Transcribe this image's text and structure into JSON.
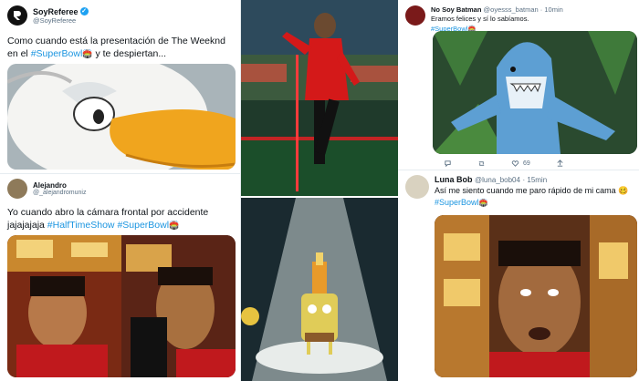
{
  "tweet1": {
    "name": "SoyReferee",
    "handle": "@SoyReferee",
    "text_pre": "Como cuando está la presentación de The Weeknd en el ",
    "hashtag": "#SuperBowl",
    "emoji": "🏟️",
    "text_post": " y te despiertan..."
  },
  "tweet2": {
    "name": "Alejandro",
    "handle": "@_alejandromuniz",
    "text_line1": "Yo cuando abro la cámara frontal por accidente",
    "text_pre": "jajajajaja ",
    "hashtag1": "#HalfTimeShow",
    "hashtag2": "#SuperBowl",
    "emoji": "🏟️"
  },
  "tweet3": {
    "name": "No Soy Batman",
    "handle": "@oyesss_batman",
    "time": "· 10min",
    "text": "Eramos felices y sí lo sabíamos.",
    "hashtag": "#SuperBowl",
    "emoji": "🏟️",
    "likes": "69"
  },
  "tweet4": {
    "name": "Luna Bob",
    "handle": "@luna_bob04",
    "time": "· 15min",
    "text": "Así me siento cuando me paro rápido de mi cama ",
    "emoji_face": "🥴",
    "hashtag": "#SuperBowl",
    "emoji": "🏟️"
  },
  "colors": {
    "link": "#1b95e0",
    "text": "#0f1419",
    "muted": "#5b7083",
    "verified": "#1da1f2"
  }
}
